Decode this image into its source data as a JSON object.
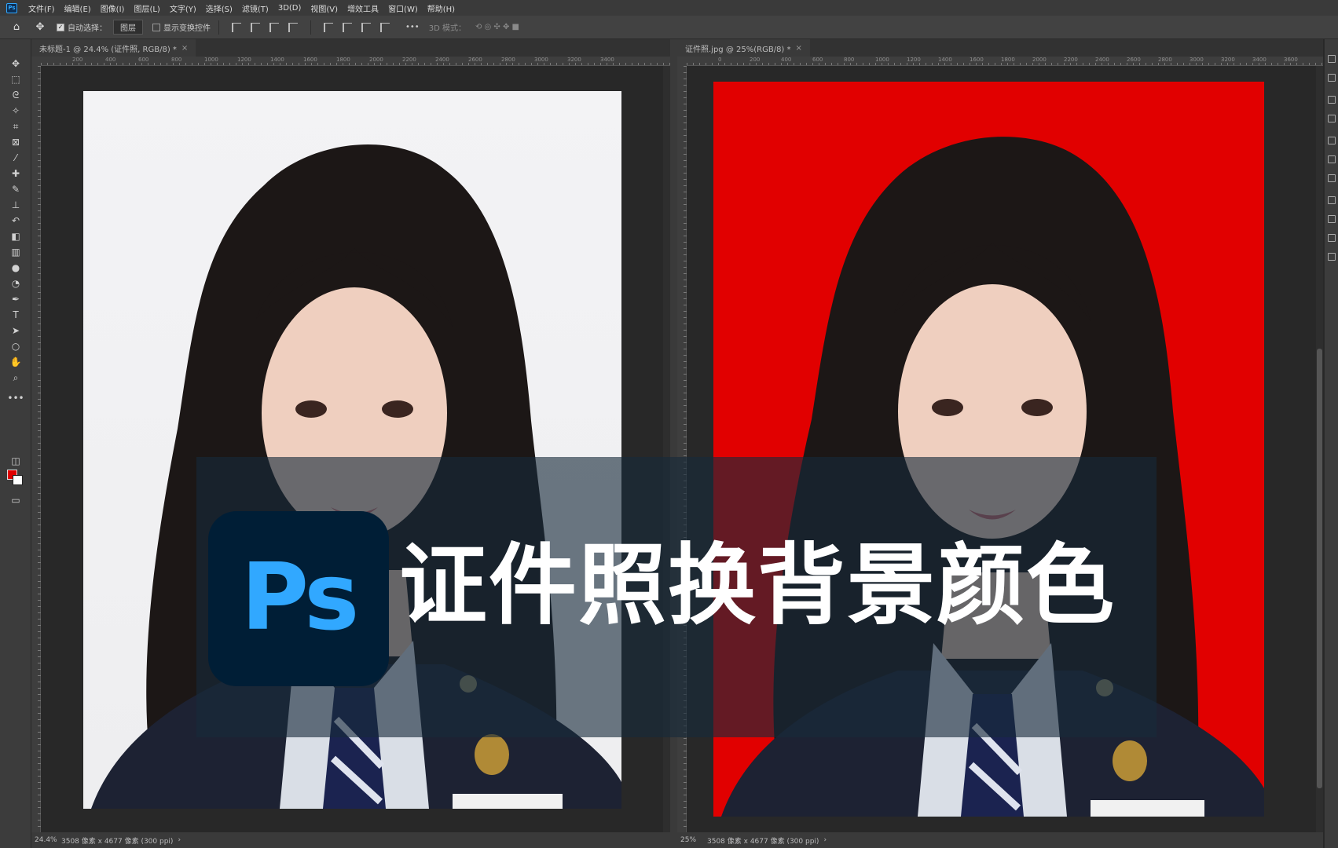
{
  "app": {
    "logo_text": "Ps",
    "menu": [
      "文件(F)",
      "编辑(E)",
      "图像(I)",
      "图层(L)",
      "文字(Y)",
      "选择(S)",
      "滤镜(T)",
      "3D(D)",
      "视图(V)",
      "增效工具",
      "窗口(W)",
      "帮助(H)"
    ]
  },
  "options_bar": {
    "auto_select_label": "自动选择：",
    "auto_select_value": "图层",
    "show_transform_label": "显示变换控件",
    "more": "•••",
    "mode_3d": "3D 模式："
  },
  "tools": [
    "move",
    "marquee",
    "lasso",
    "magic-wand",
    "crop",
    "frame",
    "eyedropper",
    "healing",
    "brush",
    "stamp",
    "history-brush",
    "eraser",
    "gradient",
    "blur",
    "dodge",
    "pen",
    "type",
    "path-select",
    "shape",
    "hand",
    "zoom",
    "more"
  ],
  "colors": {
    "foreground": "#e00000",
    "background": "#ffffff",
    "accent": "#31a8ff"
  },
  "left_doc": {
    "tab_title": "未标题-1 @ 24.4% (证件照, RGB/8) *",
    "zoom": "24.4%",
    "doc_info": "3508 像素 x 4677 像素 (300 ppi)",
    "background": "white",
    "ruler_labels": [
      "200",
      "400",
      "600",
      "800",
      "1000",
      "1200",
      "1400",
      "1600",
      "1800",
      "2000",
      "2200",
      "2400",
      "2600",
      "2800",
      "3000",
      "3200",
      "3400"
    ]
  },
  "right_doc": {
    "tab_title": "证件照.jpg @ 25%(RGB/8) *",
    "zoom": "25%",
    "doc_info": "3508 像素 x 4677 像素 (300 ppi)",
    "background": "red",
    "ruler_labels": [
      "0",
      "200",
      "400",
      "600",
      "800",
      "1000",
      "1200",
      "1400",
      "1600",
      "1800",
      "2000",
      "2200",
      "2400",
      "2600",
      "2800",
      "3000",
      "3200",
      "3400",
      "3600"
    ]
  },
  "overlay": {
    "logo": "Ps",
    "title": "证件照换背景颜色"
  }
}
